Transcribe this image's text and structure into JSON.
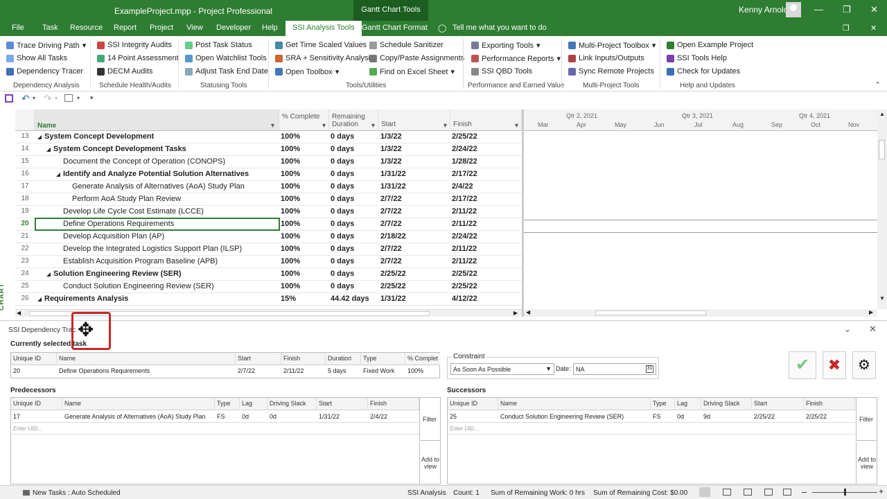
{
  "window": {
    "title": "ExampleProject.mpp  -  Project Professional",
    "context_tab": "Gantt Chart Tools",
    "user": "Kenny Arnold"
  },
  "tabs": [
    "File",
    "Task",
    "Resource",
    "Report",
    "Project",
    "View",
    "Developer",
    "Help",
    "SSI Analysis Tools",
    "Gantt Chart Format",
    "Tell me what you want to do"
  ],
  "ribbon": {
    "groups": [
      {
        "name": "Dependency Analysis",
        "items": [
          "Trace Driving Path",
          "Show All Tasks",
          "Dependency Tracer"
        ]
      },
      {
        "name": "Schedule Health/Audits",
        "items": [
          "SSI Integrity Audits",
          "14 Point Assessment",
          "DECM Audits"
        ]
      },
      {
        "name": "Statusing Tools",
        "items": [
          "Post Task Status",
          "Open Watchlist Tools",
          "Adjust Task End Date"
        ]
      },
      {
        "name": "Tools/Utilities",
        "items": [
          "Get Time Scaled Values",
          "SRA + Sensitivity Analysis",
          "Open Toolbox",
          "Schedule Sanitizer",
          "Copy/Paste Assignments",
          "Find on Excel Sheet"
        ]
      },
      {
        "name": "Performance and Earned Value",
        "items": [
          "Exporting Tools",
          "Performance Reports",
          "SSI QBD Tools"
        ]
      },
      {
        "name": "Multi-Project Tools",
        "items": [
          "Multi-Project Toolbox",
          "Link Inputs/Outputs",
          "Sync Remote Projects"
        ]
      },
      {
        "name": "Help and Updates",
        "items": [
          "Open Example Project",
          "SSI Tools Help",
          "Check for Updates"
        ]
      }
    ]
  },
  "side_label": "GANTT CHART",
  "grid": {
    "headers": [
      "Name",
      "% Complete",
      "Remaining Duration",
      "Start",
      "Finish"
    ],
    "rows": [
      {
        "id": "13",
        "name": "System Concept Development",
        "pct": "100%",
        "rem": "0 days",
        "start": "1/3/22",
        "finish": "2/25/22",
        "summary": "◢"
      },
      {
        "id": "14",
        "name": "System Concept Development Tasks",
        "pct": "100%",
        "rem": "0 days",
        "start": "1/3/22",
        "finish": "2/24/22",
        "summary": "◢"
      },
      {
        "id": "15",
        "name": "Document the Concept of Operation (CONOPS)",
        "pct": "100%",
        "rem": "0 days",
        "start": "1/3/22",
        "finish": "1/28/22",
        "summary": ""
      },
      {
        "id": "16",
        "name": "Identify and Analyze Potential Solution Alternatives",
        "pct": "100%",
        "rem": "0 days",
        "start": "1/31/22",
        "finish": "2/17/22",
        "summary": "◢"
      },
      {
        "id": "17",
        "name": "Generate Analysis of Alternatives (AoA) Study Plan",
        "pct": "100%",
        "rem": "0 days",
        "start": "1/31/22",
        "finish": "2/4/22",
        "summary": ""
      },
      {
        "id": "18",
        "name": "Perform AoA Study Plan Review",
        "pct": "100%",
        "rem": "0 days",
        "start": "2/7/22",
        "finish": "2/17/22",
        "summary": ""
      },
      {
        "id": "19",
        "name": "Develop Life Cycle Cost Estimate (LCCE)",
        "pct": "100%",
        "rem": "0 days",
        "start": "2/7/22",
        "finish": "2/11/22",
        "summary": ""
      },
      {
        "id": "20",
        "name": "Define Operations Requirements",
        "pct": "100%",
        "rem": "0 days",
        "start": "2/7/22",
        "finish": "2/11/22",
        "summary": ""
      },
      {
        "id": "21",
        "name": "Develop Acquisition Plan (AP)",
        "pct": "100%",
        "rem": "0 days",
        "start": "2/18/22",
        "finish": "2/24/22",
        "summary": ""
      },
      {
        "id": "22",
        "name": "Develop the Integrated Logistics Support Plan (ILSP)",
        "pct": "100%",
        "rem": "0 days",
        "start": "2/7/22",
        "finish": "2/11/22",
        "summary": ""
      },
      {
        "id": "23",
        "name": "Establish Acquisition Program Baseline (APB)",
        "pct": "100%",
        "rem": "0 days",
        "start": "2/7/22",
        "finish": "2/11/22",
        "summary": ""
      },
      {
        "id": "24",
        "name": "Solution Engineering Review (SER)",
        "pct": "100%",
        "rem": "0 days",
        "start": "2/25/22",
        "finish": "2/25/22",
        "summary": "◢"
      },
      {
        "id": "25",
        "name": "Conduct Solution Engineering Review (SER)",
        "pct": "100%",
        "rem": "0 days",
        "start": "2/25/22",
        "finish": "2/25/22",
        "summary": ""
      },
      {
        "id": "26",
        "name": "Requirements Analysis",
        "pct": "15%",
        "rem": "44.42 days",
        "start": "1/31/22",
        "finish": "4/12/22",
        "summary": "◢"
      }
    ]
  },
  "timeline": {
    "quarters": [
      "Qtr 2, 2021",
      "Qtr 3, 2021",
      "Qtr 4, 2021"
    ],
    "months": [
      "Mar",
      "Apr",
      "May",
      "Jun",
      "Jul",
      "Aug",
      "Sep",
      "Oct",
      "Nov"
    ]
  },
  "panel": {
    "title": "SSI Dependency Trac",
    "current_label": "Currently selected task",
    "current_headers": [
      "Unique ID",
      "Name",
      "Start",
      "Finish",
      "Duration",
      "Type",
      "% Complet"
    ],
    "current_row": [
      "20",
      "Define Operations Requirements",
      "2/7/22",
      "2/11/22",
      "5 days",
      "Fixed Work",
      "100%"
    ],
    "constraint_label": "Constraint",
    "constraint_value": "As Soon As Possible",
    "date_label": "Date:",
    "date_value": "NA",
    "pred_label": "Predecessors",
    "succ_label": "Successors",
    "pred_headers": [
      "Unique ID",
      "Name",
      "Type",
      "Lag",
      "Driving Slack",
      "Start",
      "Finish"
    ],
    "pred_row": [
      "17",
      "Generate Analysis of Alternatives (AoA) Study Plan",
      "FS",
      "0d",
      "0d",
      "1/31/22",
      "2/4/22"
    ],
    "succ_headers": [
      "Unique ID",
      "Name",
      "Type",
      "Lag",
      "Driving Slack",
      "Start",
      "Finish"
    ],
    "succ_row": [
      "25",
      "Conduct Solution Engineering Review (SER)",
      "FS",
      "0d",
      "9d",
      "2/25/22",
      "2/25/22"
    ],
    "enter_uid": "Enter UID...",
    "filter": "Filter",
    "add_view": "Add to view"
  },
  "status": {
    "new_tasks": "New Tasks : Auto Scheduled",
    "mode": "SSI Analysis",
    "count": "Count: 1",
    "work": "Sum of Remaining Work: 0 hrs",
    "cost": "Sum of Remaining Cost: $0.00"
  },
  "colors": {
    "brand": "#2e7d32",
    "highlight": "#c62828"
  }
}
